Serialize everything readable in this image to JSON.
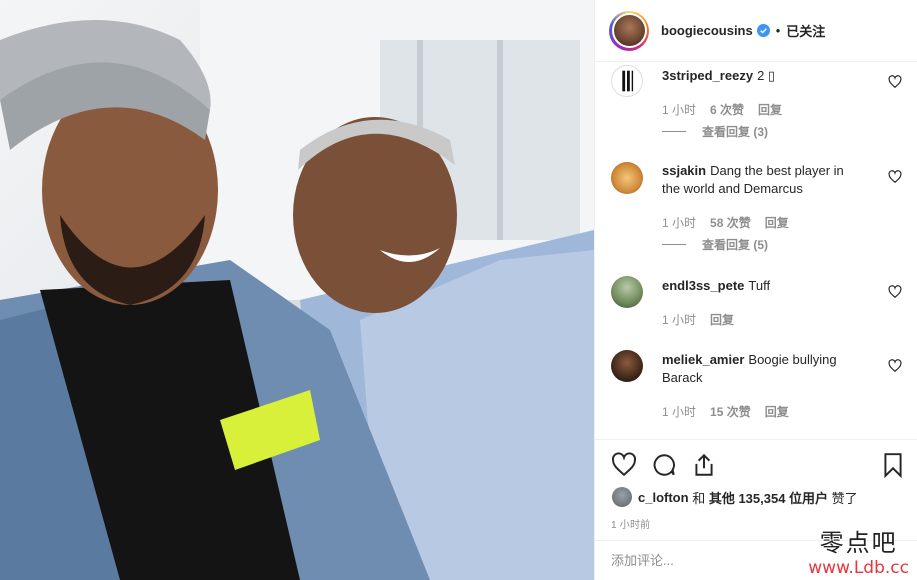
{
  "post": {
    "username": "boogiecousins",
    "dot": "•",
    "follow_label": "已关注"
  },
  "comments": [
    {
      "user": "3striped_reezy",
      "text": "2 ▯",
      "time": "1 小时",
      "likes": "6 次赞",
      "reply": "回复",
      "view_replies": "查看回复 (3)"
    },
    {
      "user": "ssjakin",
      "text": "Dang the best player in the world and Demarcus",
      "time": "1 小时",
      "likes": "58 次赞",
      "reply": "回复",
      "view_replies": "查看回复 (5)"
    },
    {
      "user": "endl3ss_pete",
      "text": "Tuff",
      "time": "1 小时",
      "reply": "回复"
    },
    {
      "user": "meliek_amier",
      "text": "Boogie bullying Barack",
      "time": "1 小时",
      "likes": "15 次赞",
      "reply": "回复"
    }
  ],
  "likes_line": {
    "user": "c_lofton",
    "and": "和",
    "others": "其他 135,354 位用户",
    "liked": "赞了"
  },
  "timestamp": "1 小时前",
  "comment_input": {
    "placeholder": "添加评论..."
  },
  "watermark": {
    "top": "零点吧",
    "bottom": "www.Ldb.cc"
  },
  "icons": [
    "verified-badge-icon",
    "heart-icon",
    "comment-icon",
    "share-icon",
    "bookmark-icon"
  ],
  "colors": {
    "verified": "#3897f0",
    "border": "#efefef",
    "meta": "#8e8e8e",
    "watermark_red": "#e8353b"
  }
}
